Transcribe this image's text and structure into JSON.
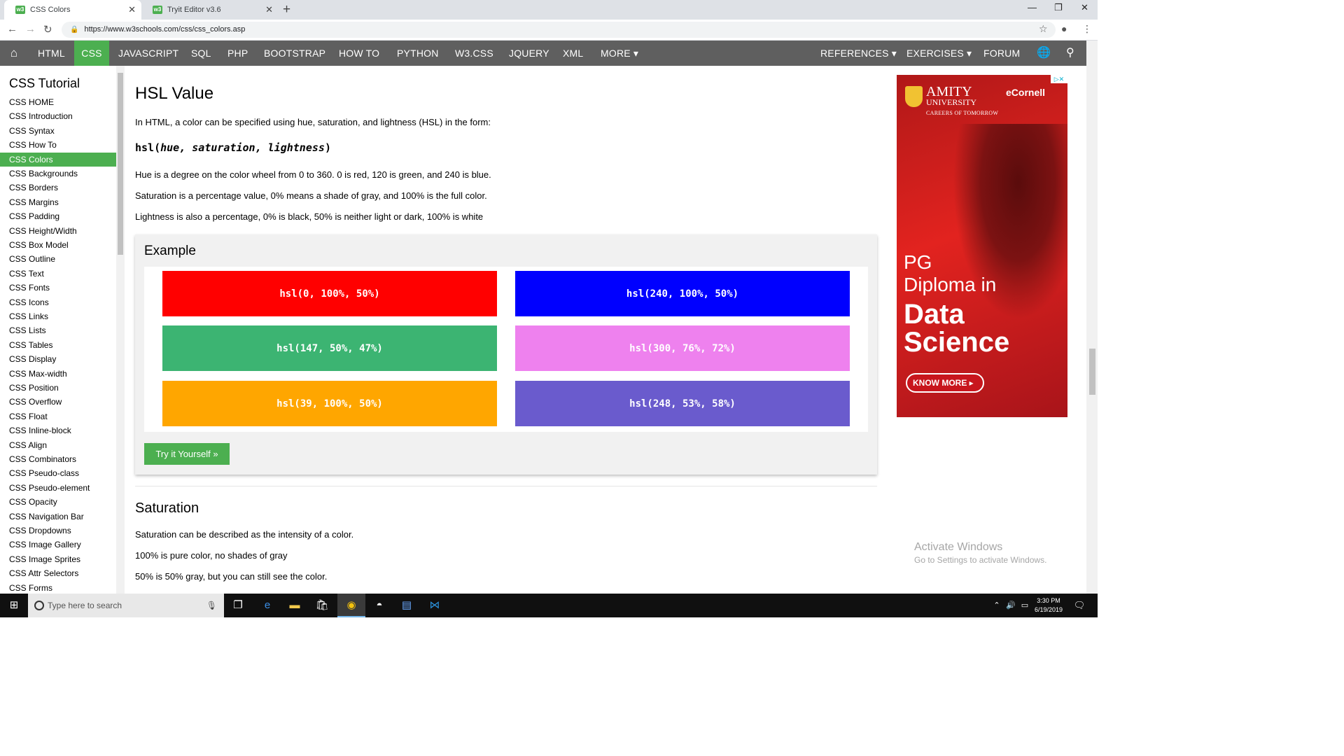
{
  "browser": {
    "tabs": [
      {
        "label": "CSS Colors",
        "icon": "w3schools-favicon"
      },
      {
        "label": "Tryit Editor v3.6",
        "icon": "w3schools-favicon"
      }
    ],
    "new_tab": "+",
    "url": "https://www.w3schools.com/css/css_colors.asp"
  },
  "topnav": {
    "items": [
      "HTML",
      "CSS",
      "JAVASCRIPT",
      "SQL",
      "PHP",
      "BOOTSTRAP",
      "HOW TO",
      "PYTHON",
      "W3.CSS",
      "JQUERY",
      "XML",
      "MORE ▾"
    ],
    "right_items": [
      "REFERENCES ▾",
      "EXERCISES ▾",
      "FORUM"
    ],
    "active": "CSS",
    "accent": "#4caf50",
    "bar_color": "#5f5f5f"
  },
  "sidebar": {
    "heading": "CSS Tutorial",
    "items": [
      "CSS HOME",
      "CSS Introduction",
      "CSS Syntax",
      "CSS How To",
      "CSS Colors",
      "CSS Backgrounds",
      "CSS Borders",
      "CSS Margins",
      "CSS Padding",
      "CSS Height/Width",
      "CSS Box Model",
      "CSS Outline",
      "CSS Text",
      "CSS Fonts",
      "CSS Icons",
      "CSS Links",
      "CSS Lists",
      "CSS Tables",
      "CSS Display",
      "CSS Max-width",
      "CSS Position",
      "CSS Overflow",
      "CSS Float",
      "CSS Inline-block",
      "CSS Align",
      "CSS Combinators",
      "CSS Pseudo-class",
      "CSS Pseudo-element",
      "CSS Opacity",
      "CSS Navigation Bar",
      "CSS Dropdowns",
      "CSS Image Gallery",
      "CSS Image Sprites",
      "CSS Attr Selectors",
      "CSS Forms"
    ],
    "active": "CSS Colors"
  },
  "main": {
    "heading": "HSL Value",
    "intro": "In HTML, a color can be specified using hue, saturation, and lightness (HSL) in the form:",
    "syntax_fn": "hsl(",
    "syntax_args": "hue, saturation, lightness",
    "syntax_close": ")",
    "para1": "Hue is a degree on the color wheel from 0 to 360. 0 is red, 120 is green, and 240 is blue.",
    "para2": "Saturation is a percentage value, 0% means a shade of gray, and 100% is the full color.",
    "para3": "Lightness is also a percentage, 0% is black, 50% is neither light or dark, 100% is white",
    "example_title": "Example",
    "swatches": [
      {
        "label": "hsl(0, 100%, 50%)",
        "color": "hsl(0, 100%, 50%)"
      },
      {
        "label": "hsl(240, 100%, 50%)",
        "color": "hsl(240, 100%, 50%)"
      },
      {
        "label": "hsl(147, 50%, 47%)",
        "color": "hsl(147, 50%, 47%)"
      },
      {
        "label": "hsl(300, 76%, 72%)",
        "color": "hsl(300, 76%, 72%)"
      },
      {
        "label": "hsl(39, 100%, 50%)",
        "color": "hsl(39, 100%, 50%)"
      },
      {
        "label": "hsl(248, 53%, 58%)",
        "color": "hsl(248, 53%, 58%)"
      }
    ],
    "try_button": "Try it Yourself »",
    "heading2": "Saturation",
    "sat_para1": "Saturation can be described as the intensity of a color.",
    "sat_para2": "100% is pure color, no shades of gray",
    "sat_para3": "50% is 50% gray, but you can still see the color."
  },
  "ad": {
    "brand1": "AMITY",
    "brand1_sub": "UNIVERSITY",
    "brand1_tag": "CAREERS OF TOMORROW",
    "brand2": "eCornell",
    "line1": "PG",
    "line2": "Diploma in",
    "line3": "Data",
    "line4": "Science",
    "cta": "KNOW MORE ▸",
    "adchoices": "▷✕"
  },
  "watermark": {
    "line1": "Activate Windows",
    "line2": "Go to Settings to activate Windows."
  },
  "taskbar": {
    "search_placeholder": "Type here to search",
    "time": "3:30 PM",
    "date": "6/19/2019"
  }
}
